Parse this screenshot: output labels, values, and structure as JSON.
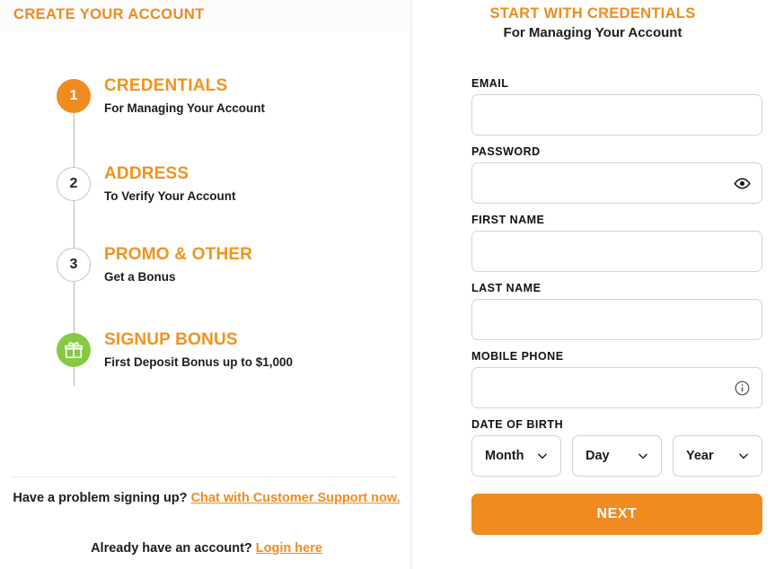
{
  "left": {
    "header_title": "CREATE YOUR ACCOUNT",
    "steps": [
      {
        "badge": "1",
        "title": "CREDENTIALS",
        "subtitle": "For Managing Your Account",
        "state": "active",
        "icon": "step-number-1"
      },
      {
        "badge": "2",
        "title": "ADDRESS",
        "subtitle": "To Verify Your Account",
        "state": "idle",
        "icon": "step-number-2"
      },
      {
        "badge": "3",
        "title": "PROMO & OTHER",
        "subtitle": "Get a Bonus",
        "state": "idle",
        "icon": "step-number-3"
      },
      {
        "badge": "",
        "title": "SIGNUP BONUS",
        "subtitle": "First Deposit Bonus up to $1,000",
        "state": "bonus",
        "icon": "gift-icon"
      }
    ],
    "footer": {
      "support_prompt": "Have a problem signing up?",
      "support_link": "Chat with Customer Support now.",
      "login_prompt": "Already have an account?",
      "login_link": "Login here"
    }
  },
  "right": {
    "title": "START WITH CREDENTIALS",
    "subtitle": "For Managing Your Account",
    "fields": [
      {
        "label": "EMAIL",
        "value": "",
        "placeholder": "",
        "type": "email",
        "adornment": null
      },
      {
        "label": "PASSWORD",
        "value": "",
        "placeholder": "",
        "type": "password",
        "adornment": "eye-icon"
      },
      {
        "label": "FIRST NAME",
        "value": "",
        "placeholder": "",
        "type": "text",
        "adornment": null
      },
      {
        "label": "LAST NAME",
        "value": "",
        "placeholder": "",
        "type": "text",
        "adornment": null
      },
      {
        "label": "MOBILE PHONE",
        "value": "",
        "placeholder": "",
        "type": "tel",
        "adornment": "info-icon"
      }
    ],
    "dob": {
      "label": "DATE OF BIRTH",
      "month": "Month",
      "day": "Day",
      "year": "Year"
    },
    "next_label": "NEXT"
  },
  "colors": {
    "accent_orange": "#ef8b20",
    "bonus_green": "#85ca42",
    "text_dark": "#1d1d1d",
    "border_gray": "#d3d3d3"
  }
}
